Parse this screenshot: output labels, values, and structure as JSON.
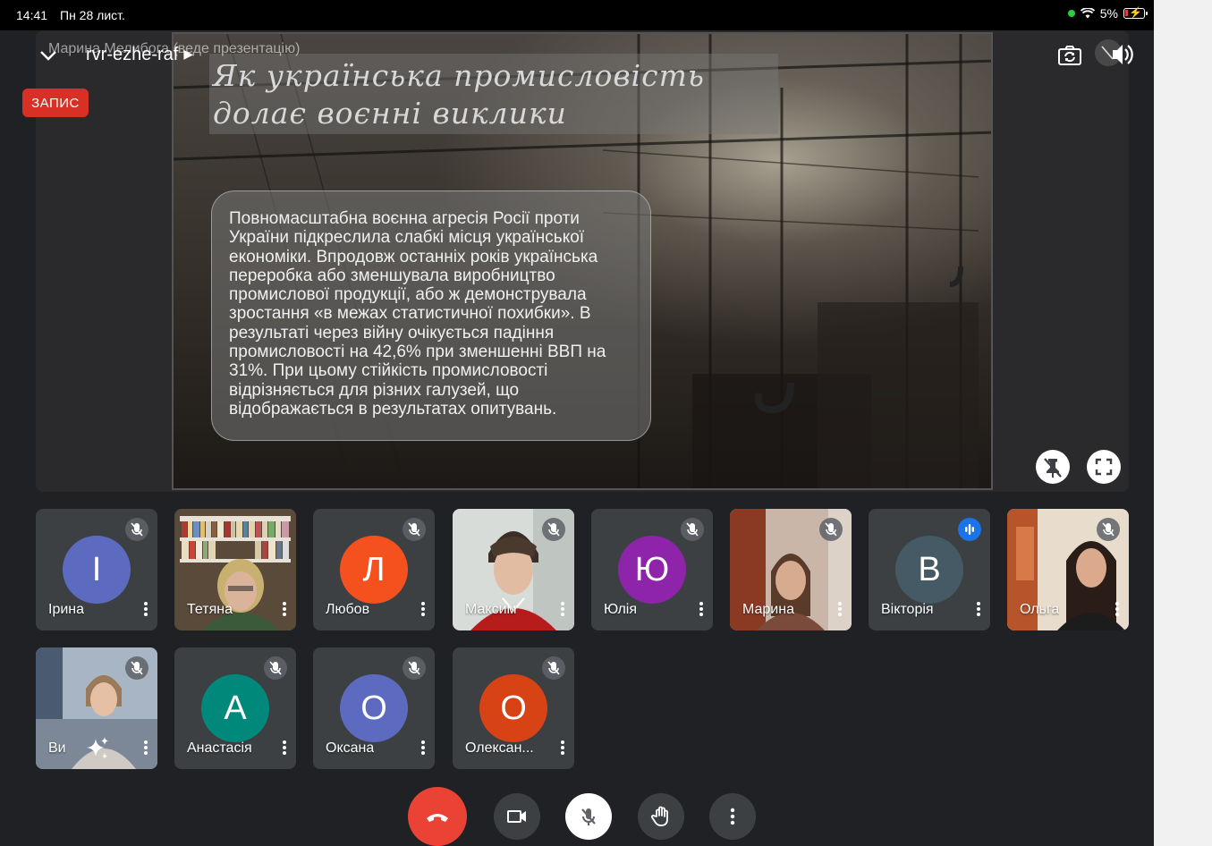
{
  "status_bar": {
    "time": "14:41",
    "date": "Пн 28 лист.",
    "battery": "5%"
  },
  "meeting": {
    "code": "rvr-ezhe-raf",
    "presenter_label": "Марина Мелибога (веде презентацію)",
    "recording_label": "ЗАПИС"
  },
  "slide": {
    "title_line1": "Як українська промисловість",
    "title_line2": "долає воєнні виклики",
    "body": "Повномасштабна воєнна агресія Росії проти України підкреслила слабкі місця української економіки. Впродовж останніх років українська переробка або зменшувала виробництво промислової продукції, або ж демонструвала зростання «в межах статистичної похибки». В результаті через війну очікується падіння промисловості на 42,6% при зменшенні ВВП на 31%. При цьому стійкість промисловості відрізняється для різних галузей, що відображається в результатах опитувань."
  },
  "participants": [
    {
      "name": "Ірина",
      "initial": "І",
      "color": "#5c6bc0",
      "video": false,
      "mic": "muted"
    },
    {
      "name": "Тетяна",
      "initial": "",
      "color": "",
      "video": true,
      "mic": "none"
    },
    {
      "name": "Любов",
      "initial": "Л",
      "color": "#f4511e",
      "video": false,
      "mic": "muted"
    },
    {
      "name": "Максим",
      "initial": "",
      "color": "",
      "video": true,
      "mic": "muted"
    },
    {
      "name": "Юлія",
      "initial": "Ю",
      "color": "#8e24aa",
      "video": false,
      "mic": "muted"
    },
    {
      "name": "Марина",
      "initial": "",
      "color": "",
      "video": true,
      "mic": "muted"
    },
    {
      "name": "Вікторія",
      "initial": "В",
      "color": "#455a64",
      "video": false,
      "mic": "speaking"
    },
    {
      "name": "Ольга",
      "initial": "",
      "color": "",
      "video": true,
      "mic": "muted"
    },
    {
      "name": "Ви",
      "initial": "",
      "color": "",
      "video": true,
      "mic": "muted"
    },
    {
      "name": "Анастасія",
      "initial": "А",
      "color": "#00897b",
      "video": false,
      "mic": "muted"
    },
    {
      "name": "Оксана",
      "initial": "О",
      "color": "#5c6bc0",
      "video": false,
      "mic": "muted"
    },
    {
      "name": "Олексан...",
      "initial": "О",
      "color": "#d84315",
      "video": false,
      "mic": "muted"
    }
  ],
  "icons": {
    "camera_switch": "camera-switch-icon",
    "speaker": "speaker-icon",
    "hangup": "phone-hangup-icon",
    "camera": "videocam-icon",
    "mic": "mic-off-icon",
    "hand": "raise-hand-icon",
    "more": "more-vert-icon"
  },
  "colors": {
    "hangup": "#ea4335",
    "recording": "#d93025",
    "speaking": "#1a73e8",
    "background": "#202124"
  }
}
